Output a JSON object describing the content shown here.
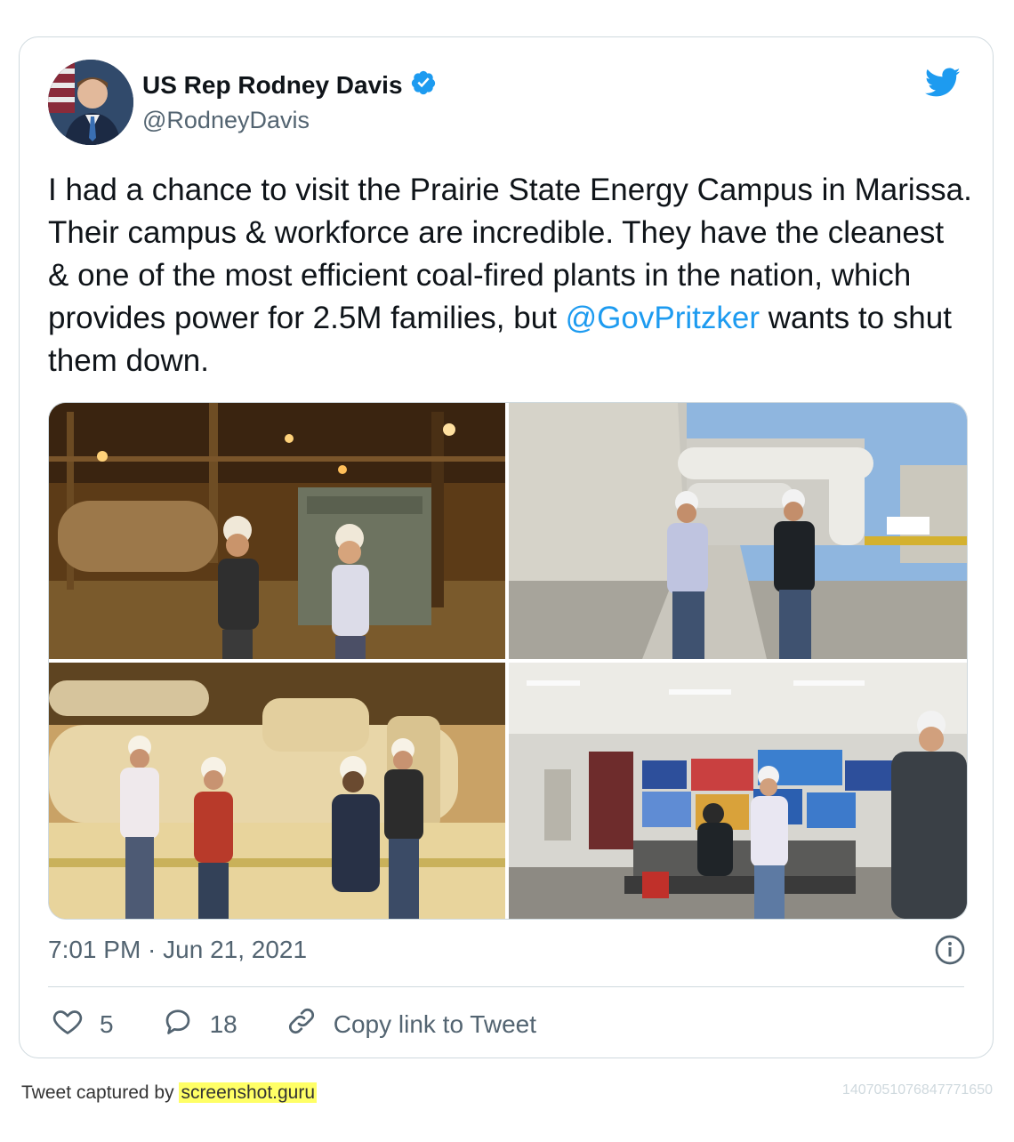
{
  "author": {
    "display_name": "US Rep Rodney Davis",
    "handle": "@RodneyDavis",
    "verified": true
  },
  "tweet": {
    "text_part1": "I had a chance to visit the Prairie State Energy Campus in Marissa. Their campus & workforce are incredible. They have the cleanest & one of the most efficient coal-fired plants in the nation, which provides power for 2.5M families, but ",
    "mention": "@GovPritzker",
    "text_part2": " wants to shut them down.",
    "timestamp": "7:01 PM · Jun 21, 2021"
  },
  "actions": {
    "likes": "5",
    "replies": "18",
    "copy_link_label": "Copy link to Tweet"
  },
  "footer": {
    "captured_by_prefix": "Tweet captured by ",
    "captured_by_link": "screenshot.guru",
    "tweet_id": "1407051076847771650"
  },
  "icons": {
    "brand": "twitter-bird-icon",
    "verified": "verified-badge-icon",
    "info": "info-icon",
    "like": "heart-icon",
    "reply": "reply-bubble-icon",
    "link": "link-icon"
  },
  "colors": {
    "accent": "#1d9bf0",
    "text": "#0f1419",
    "muted": "#536471",
    "border": "#cfd9de",
    "highlight": "#ffff66"
  }
}
